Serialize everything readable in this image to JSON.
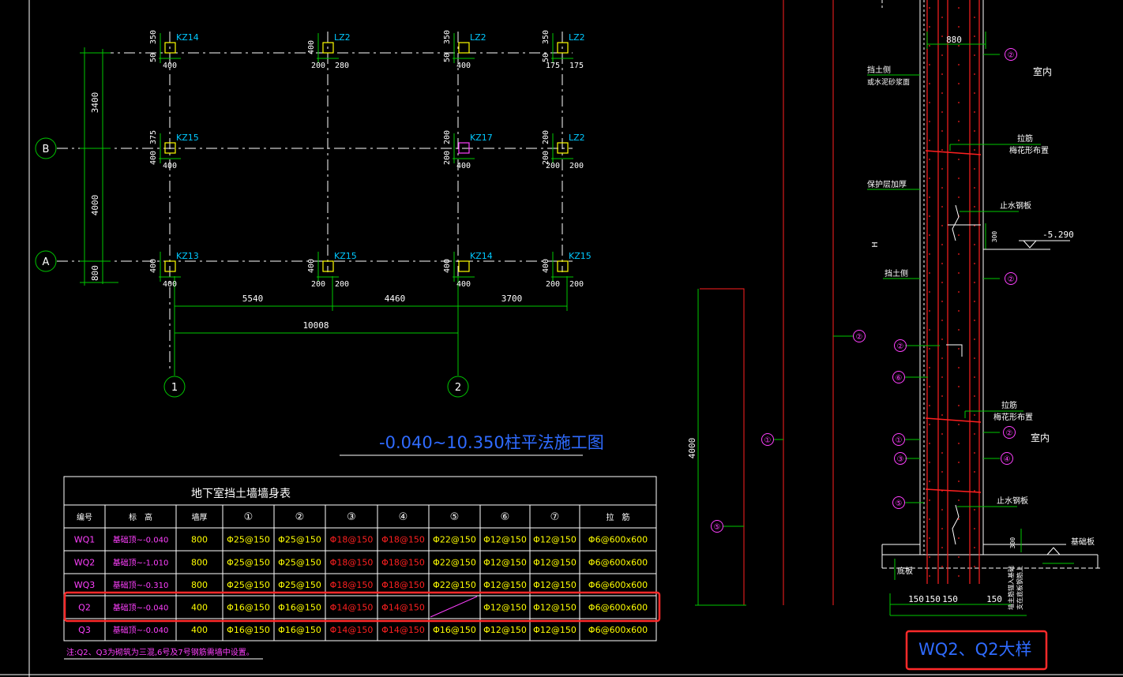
{
  "colors": {
    "background": "#000000",
    "green": "#00c800",
    "white": "#ffffff",
    "yellow": "#ffff00",
    "red": "#ff2020",
    "magenta": "#ff40ff",
    "cyan": "#00c8ff",
    "blue": "#2f6bff",
    "highlight": "#ff2a2a"
  },
  "plan": {
    "axes_rows": [
      "B",
      "A"
    ],
    "axes_cols": [
      "1",
      "2"
    ],
    "left_dims": [
      "3400",
      "4000",
      "800"
    ],
    "bottom_dims": [
      "5540",
      "4460",
      "3700"
    ],
    "overall_dim": "10008",
    "columns": {
      "r0c0": {
        "name": "KZ14",
        "v": [
          "350",
          "50"
        ],
        "h": [
          "400"
        ]
      },
      "r0c1": {
        "name": "LZ2",
        "v": [
          "400"
        ],
        "h": [
          "200",
          "280"
        ]
      },
      "r0c2": {
        "name": "LZ2",
        "v": [
          "350",
          "50"
        ],
        "h": [
          "400"
        ]
      },
      "r0c3": {
        "name": "LZ2",
        "v": [
          "350",
          "50"
        ],
        "h": [
          "175",
          "175"
        ]
      },
      "r1c0": {
        "name": "KZ15",
        "v": [
          "375",
          "400"
        ],
        "h": [
          "400"
        ]
      },
      "r1c2": {
        "name": "KZ17",
        "v": [
          "200",
          "200"
        ],
        "h": [
          "400"
        ]
      },
      "r1c3": {
        "name": "LZ2",
        "v": [
          "200",
          "200"
        ],
        "h": [
          "200",
          "200"
        ]
      },
      "r2c0": {
        "name": "KZ13",
        "v": [
          "400"
        ],
        "h": [
          "400"
        ]
      },
      "r2c1": {
        "name": "KZ15",
        "v": [
          "400"
        ],
        "h": [
          "200",
          "200"
        ]
      },
      "r2c2": {
        "name": "KZ14",
        "v": [
          "400"
        ],
        "h": [
          "400"
        ]
      },
      "r2c3": {
        "name": "KZ15",
        "v": [
          "400"
        ],
        "h": [
          "200",
          "200"
        ]
      }
    },
    "title": "-0.040~10.350柱平法施工图"
  },
  "table": {
    "title": "地下室挡土墙墙身表",
    "headers": [
      "编号",
      "标　高",
      "墙厚",
      "①",
      "②",
      "③",
      "④",
      "⑤",
      "⑥",
      "⑦",
      "拉　筋"
    ],
    "rows": [
      [
        "WQ1",
        "基础顶~-0.040",
        "800",
        "Φ25@150",
        "Φ25@150",
        "Φ18@150",
        "Φ18@150",
        "Φ22@150",
        "Φ12@150",
        "Φ12@150",
        "Φ6@600x600"
      ],
      [
        "WQ2",
        "基础顶~-1.010",
        "800",
        "Φ25@150",
        "Φ25@150",
        "Φ18@150",
        "Φ18@150",
        "Φ22@150",
        "Φ12@150",
        "Φ12@150",
        "Φ6@600x600"
      ],
      [
        "WQ3",
        "基础顶~-0.310",
        "800",
        "Φ25@150",
        "Φ25@150",
        "Φ18@150",
        "Φ18@150",
        "Φ22@150",
        "Φ12@150",
        "Φ12@150",
        "Φ6@600x600"
      ],
      [
        "Q2",
        "基础顶~-0.040",
        "400",
        "Φ16@150",
        "Φ16@150",
        "Φ14@150",
        "Φ14@150",
        "",
        "Φ12@150",
        "Φ12@150",
        "Φ6@600x600"
      ],
      [
        "Q3",
        "基础顶~-0.040",
        "400",
        "Φ16@150",
        "Φ16@150",
        "Φ14@150",
        "Φ14@150",
        "Φ16@150",
        "Φ12@150",
        "Φ12@150",
        "Φ6@600x600"
      ]
    ],
    "note": "注:Q2、Q3为砌筑为三混,6号及7号钢筋需墙中设置。"
  },
  "mid_detail": {
    "height_dim": "4000",
    "markers": [
      "①",
      "②",
      "⑤"
    ]
  },
  "section": {
    "top_dim": "880",
    "labels": {
      "soil_face": "挡土侧",
      "waterproof": "或水泥砂浆面",
      "indoor_top": "室内",
      "tie_bar": "拉筋",
      "plum_layout": "梅花形布置",
      "protect": "保护层加厚",
      "waterstop_top": "止水钢板",
      "elev": "-5.290",
      "dim300": "300",
      "h": "H",
      "soil_face2": "挡土侧",
      "tie_bar2": "拉筋",
      "plum_layout2": "梅花形布置",
      "indoor_bottom": "室内",
      "waterstop_bottom": "止水钢板",
      "base": "基础板",
      "floor": "底板",
      "dim300b": "300",
      "note_vert": "墙主筋锚入基础",
      "note_vert2": "支在底板钢筋上",
      "bottom_dims": [
        "150",
        "150",
        "150",
        "150"
      ]
    },
    "markers": {
      "m2a": "②",
      "m2b": "②",
      "m2c": "②",
      "m2d": "②",
      "m6": "⑥",
      "m1": "①",
      "m3": "③",
      "m4": "④",
      "m5": "⑤"
    },
    "title": "WQ2、Q2大样"
  }
}
